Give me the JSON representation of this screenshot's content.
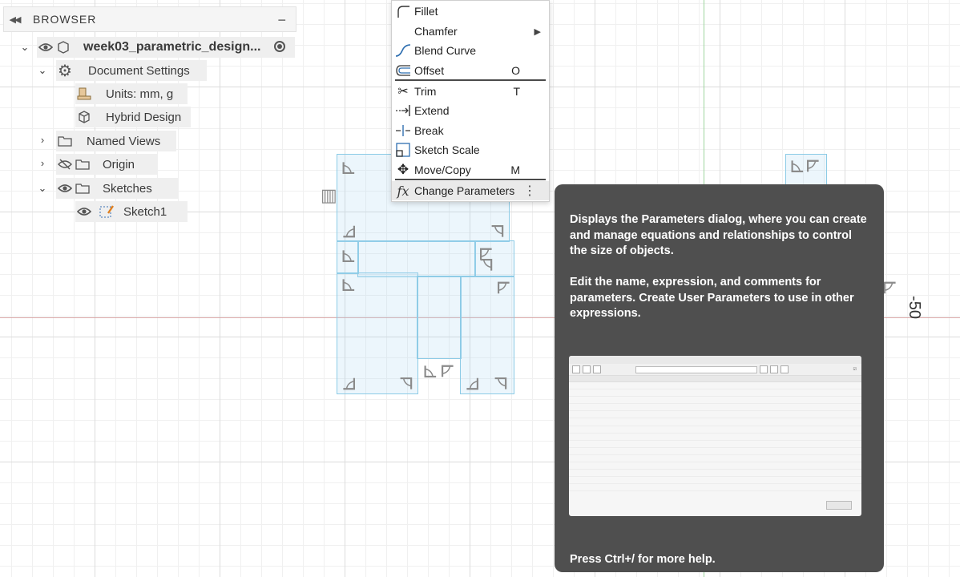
{
  "browser": {
    "title": "BROWSER",
    "collapse_icon": "double-chevron-left-icon",
    "minimize_icon": "minus-icon",
    "root": {
      "label": "week03_parametric_design...",
      "icon": "component-icon",
      "visibility": "eye-icon",
      "active": "radio-active-icon"
    },
    "items": [
      {
        "label": "Document Settings",
        "icon": "gear-icon",
        "expanded": true
      },
      {
        "label": "Units: mm, g",
        "icon": "units-icon"
      },
      {
        "label": "Hybrid Design",
        "icon": "box-icon"
      },
      {
        "label": "Named Views",
        "icon": "folder-icon",
        "expanded": false
      },
      {
        "label": "Origin",
        "icon": "folder-icon",
        "visibility": "eye-hidden-icon",
        "expanded": false
      },
      {
        "label": "Sketches",
        "icon": "folder-icon",
        "visibility": "eye-icon",
        "expanded": true
      },
      {
        "label": "Sketch1",
        "icon": "sketch-icon",
        "visibility": "eye-icon"
      }
    ]
  },
  "menu": {
    "items": [
      {
        "label": "Fillet",
        "icon": "fillet-icon",
        "shortcut": ""
      },
      {
        "label": "Chamfer",
        "icon": "",
        "shortcut": "",
        "submenu": true
      },
      {
        "label": "Blend Curve",
        "icon": "blend-curve-icon",
        "shortcut": ""
      },
      {
        "label": "Offset",
        "icon": "offset-icon",
        "shortcut": "O"
      },
      {
        "label": "Trim",
        "icon": "trim-icon",
        "shortcut": "T"
      },
      {
        "label": "Extend",
        "icon": "extend-icon",
        "shortcut": ""
      },
      {
        "label": "Break",
        "icon": "break-icon",
        "shortcut": ""
      },
      {
        "label": "Sketch Scale",
        "icon": "sketch-scale-icon",
        "shortcut": ""
      },
      {
        "label": "Move/Copy",
        "icon": "move-icon",
        "shortcut": "M"
      },
      {
        "label": "Change Parameters",
        "icon": "fx-icon",
        "shortcut": "",
        "hover": true
      }
    ]
  },
  "tooltip": {
    "paragraph1": "Displays the Parameters dialog, where you can create and manage equations and relationships to control the size of objects.",
    "paragraph2": "Edit the name, expression, and comments for parameters. Create User Parameters to use in other expressions.",
    "help": "Press Ctrl+/ for more help."
  },
  "canvas": {
    "dimension_label": "-50",
    "axis_x_color": "#d9a8a8",
    "axis_y_color": "#9ed59e",
    "sketch_color": "#8ccbe6"
  }
}
